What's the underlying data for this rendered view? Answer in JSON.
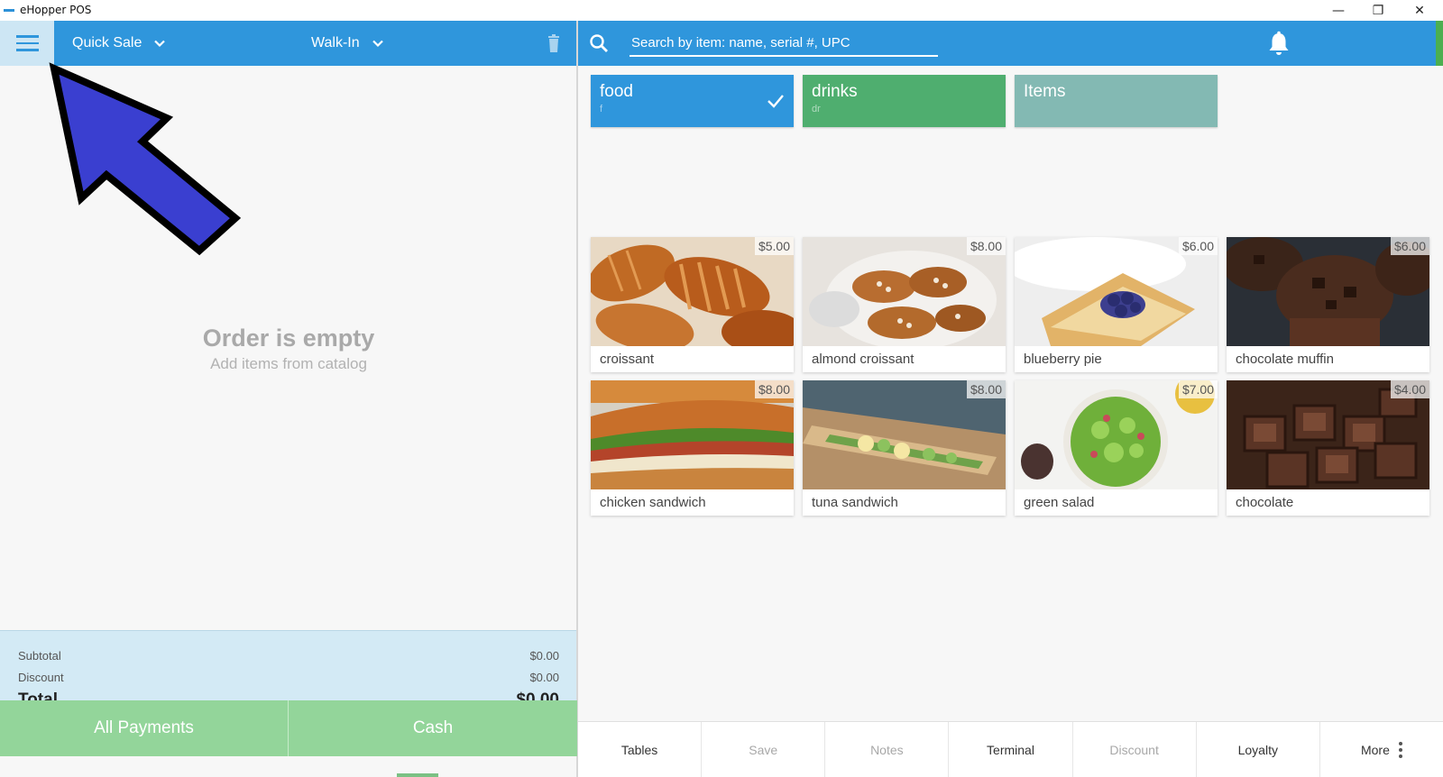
{
  "window": {
    "title": "eHopper POS",
    "minimize": "—",
    "maximize": "❐",
    "close": "✕"
  },
  "order_header": {
    "order_type": "Quick Sale",
    "customer": "Walk-In"
  },
  "order": {
    "empty_title": "Order is empty",
    "empty_subtitle": "Add items from catalog"
  },
  "totals": {
    "subtotal_label": "Subtotal",
    "subtotal_value": "$0.00",
    "discount_label": "Discount",
    "discount_value": "$0.00",
    "total_label": "Total",
    "total_value": "$0.00"
  },
  "payments": {
    "all_payments": "All Payments",
    "cash": "Cash"
  },
  "search": {
    "placeholder": "Search by item: name, serial #, UPC"
  },
  "categories": [
    {
      "name": "food",
      "code": "f",
      "selected": true,
      "color": "#2f96dc"
    },
    {
      "name": "drinks",
      "code": "dr",
      "selected": false,
      "color": "#4fae6f"
    },
    {
      "name": "Items",
      "code": "",
      "selected": false,
      "color": "#83b9b3"
    }
  ],
  "items": [
    {
      "name": "croissant",
      "price": "$5.00"
    },
    {
      "name": "almond croissant",
      "price": "$8.00"
    },
    {
      "name": "blueberry pie",
      "price": "$6.00"
    },
    {
      "name": "chocolate muffin",
      "price": "$6.00"
    },
    {
      "name": "chicken sandwich",
      "price": "$8.00"
    },
    {
      "name": "tuna sandwich",
      "price": "$8.00"
    },
    {
      "name": "green salad",
      "price": "$7.00"
    },
    {
      "name": "chocolate",
      "price": "$4.00"
    }
  ],
  "toolbar": {
    "tables": "Tables",
    "save": "Save",
    "notes": "Notes",
    "terminal": "Terminal",
    "discount": "Discount",
    "loyalty": "Loyalty",
    "more": "More"
  },
  "colors": {
    "header_blue": "#2f96dc",
    "pay_green": "#93d59a",
    "totals_bg": "#d3eaf5",
    "arrow_fill": "#3a3fd0"
  }
}
